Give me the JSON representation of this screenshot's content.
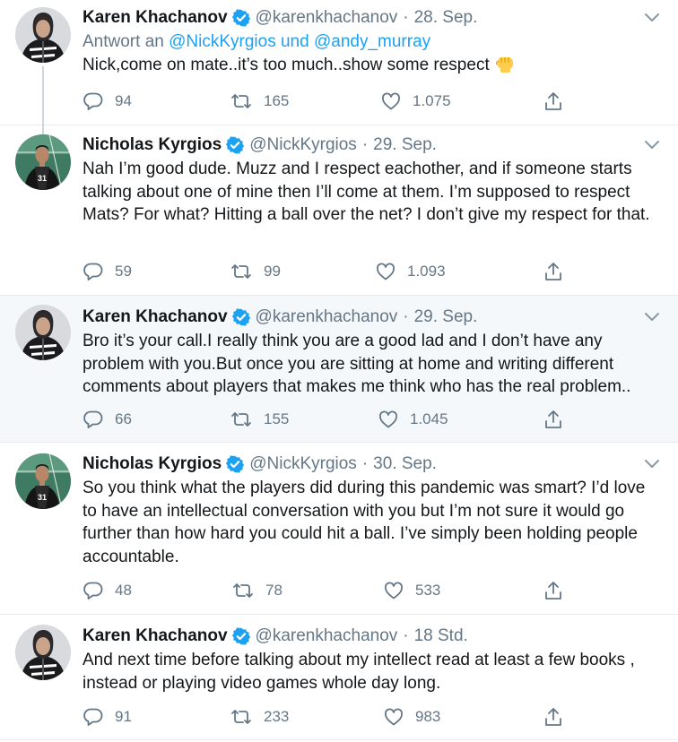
{
  "thread": [
    {
      "name": "Karen Khachanov",
      "handle": "@karenkhachanov",
      "separator": "·",
      "date": "28. Sep.",
      "reply_prefix": "Antwort an ",
      "reply_user_1": "@NickKyrgios",
      "reply_joiner": " und ",
      "reply_user_2": "@andy_murray",
      "text": "Nick,come on mate..it’s too much..show some respect",
      "emoji": "raised-fist",
      "avatar": "hooded-jacket",
      "replies": "94",
      "retweets": "165",
      "likes": "1.075"
    },
    {
      "name": "Nicholas Kyrgios",
      "handle": "@NickKyrgios",
      "separator": "·",
      "date": "29. Sep.",
      "text": "Nah I’m good dude. Muzz and I respect eachother, and if someone starts talking about one of mine then I’ll come at them. I’m supposed to respect Mats? For what? Hitting a ball over the net? I don’t give my respect for that.",
      "avatar": "jersey-player",
      "replies": "59",
      "retweets": "99",
      "likes": "1.093"
    },
    {
      "name": "Karen Khachanov",
      "handle": "@karenkhachanov",
      "separator": "·",
      "date": "29. Sep.",
      "text": "Bro it’s your call.I really think you are a good lad and I don’t have any problem with you.But once you are sitting at home and writing different comments about players that makes me think who has the real problem..",
      "avatar": "hooded-jacket",
      "replies": "66",
      "retweets": "155",
      "likes": "1.045"
    },
    {
      "name": "Nicholas Kyrgios",
      "handle": "@NickKyrgios",
      "separator": "·",
      "date": "30. Sep.",
      "text": "So you think what the players did during this pandemic was smart? I’d love to have an intellectual conversation with you but I’m not sure it would go further than how hard you could hit a ball. I’ve simply been holding people accountable.",
      "avatar": "jersey-player",
      "replies": "48",
      "retweets": "78",
      "likes": "533"
    },
    {
      "name": "Karen Khachanov",
      "handle": "@karenkhachanov",
      "separator": "·",
      "date": "18 Std.",
      "text": "And next time before talking about my intellect read at least a few books , instead or playing video games whole day long.",
      "avatar": "hooded-jacket",
      "replies": "91",
      "retweets": "233",
      "likes": "983"
    }
  ],
  "colors": {
    "accent": "#1da1f2",
    "text_primary": "#14171a",
    "text_secondary": "#657786",
    "highlight_bg": "#f5f8fa",
    "thread_line": "#ccd6dd",
    "emoji_fist": "#ffcc4d"
  }
}
